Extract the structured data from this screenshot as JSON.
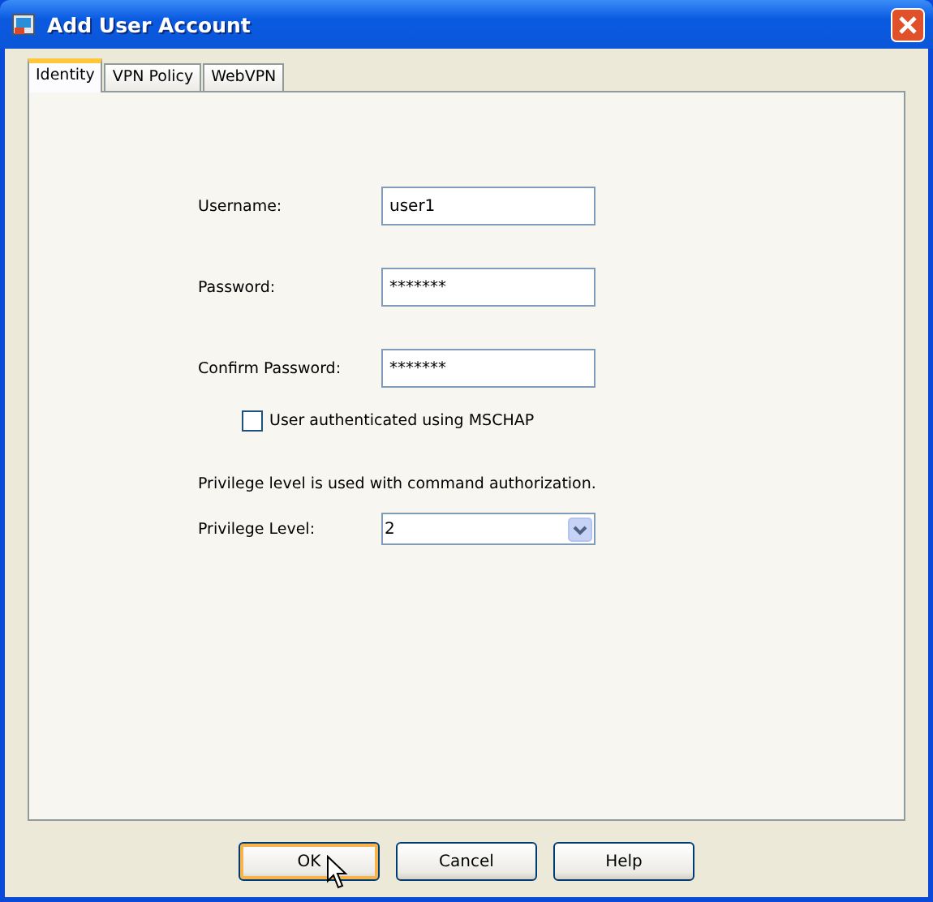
{
  "window": {
    "title": "Add User Account"
  },
  "tabs": [
    {
      "label": "Identity",
      "selected": true
    },
    {
      "label": "VPN Policy",
      "selected": false
    },
    {
      "label": "WebVPN",
      "selected": false
    }
  ],
  "fields": [
    {
      "label": "Username:",
      "value": "user1"
    },
    {
      "label": "Password:",
      "value": "*******"
    },
    {
      "label": "Confirm Password:",
      "value": "*******"
    }
  ],
  "mschap": {
    "label": "User authenticated using MSCHAP",
    "checked": false
  },
  "privilege_note": "Privilege level is used with command authorization.",
  "privilege": {
    "label": "Privilege Level:",
    "value": "2"
  },
  "buttons": [
    {
      "label": "OK",
      "selected": true
    },
    {
      "label": "Cancel",
      "selected": false
    },
    {
      "label": "Help",
      "selected": false
    }
  ]
}
